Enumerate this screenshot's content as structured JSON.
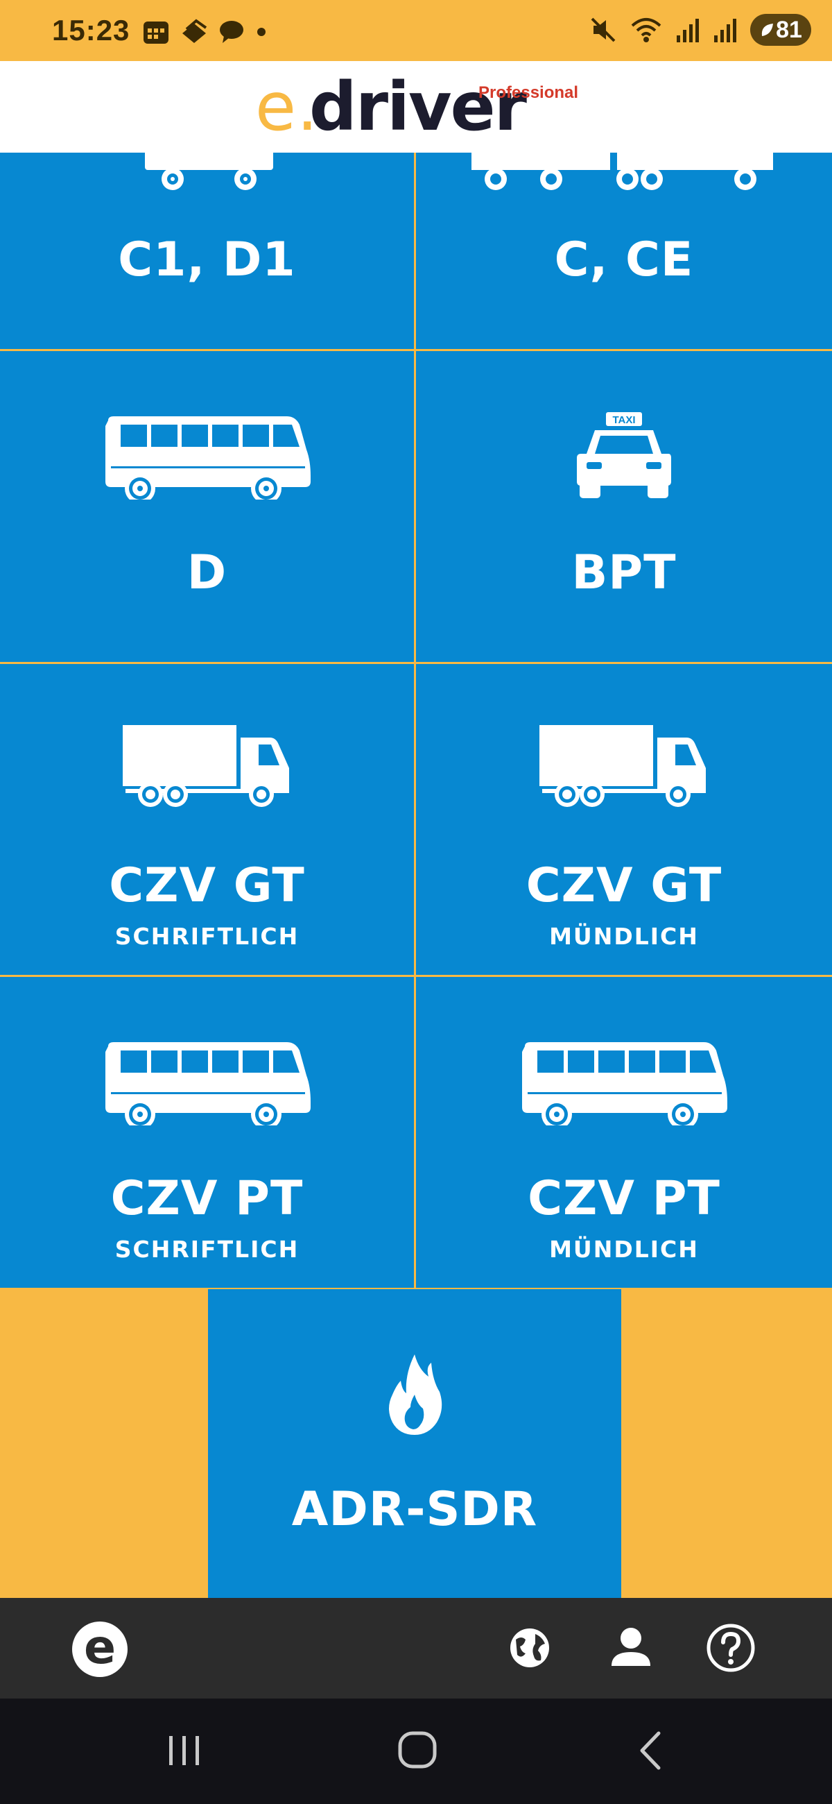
{
  "status_bar": {
    "time": "15:23",
    "left_icons": [
      "calendar-icon",
      "layers-icon",
      "chat-bubble-icon",
      "dot-icon"
    ],
    "right_icons": [
      "mute-icon",
      "wifi-icon",
      "signal-icon",
      "signal-icon"
    ],
    "battery": "81"
  },
  "header": {
    "logo_e": "e",
    "logo_dot": ".",
    "logo_driver": "driver",
    "logo_professional": "Professional"
  },
  "tiles": [
    {
      "title": "C1, D1",
      "subtitle": "",
      "icon": "small-truck-icon"
    },
    {
      "title": "C, CE",
      "subtitle": "",
      "icon": "truck-trailer-icon"
    },
    {
      "title": "D",
      "subtitle": "",
      "icon": "bus-icon"
    },
    {
      "title": "BPT",
      "subtitle": "",
      "icon": "taxi-icon"
    },
    {
      "title": "CZV GT",
      "subtitle": "SCHRIFTLICH",
      "icon": "truck-icon"
    },
    {
      "title": "CZV GT",
      "subtitle": "MÜNDLICH",
      "icon": "truck-icon"
    },
    {
      "title": "CZV PT",
      "subtitle": "SCHRIFTLICH",
      "icon": "bus-icon"
    },
    {
      "title": "CZV PT",
      "subtitle": "MÜNDLICH",
      "icon": "bus-icon"
    },
    {
      "title": "ADR-SDR",
      "subtitle": "",
      "icon": "flame-icon"
    }
  ],
  "taxi_sign": "TAXI",
  "bottom_bar": {
    "home_letter": "e",
    "icons": [
      "globe-icon",
      "user-icon",
      "help-icon"
    ]
  },
  "system_nav": {
    "icons": [
      "recent-apps-icon",
      "home-icon",
      "back-icon"
    ]
  },
  "colors": {
    "accent_yellow": "#f8b944",
    "tile_blue": "#0788d1",
    "bar_dark": "#2c2c2c"
  }
}
